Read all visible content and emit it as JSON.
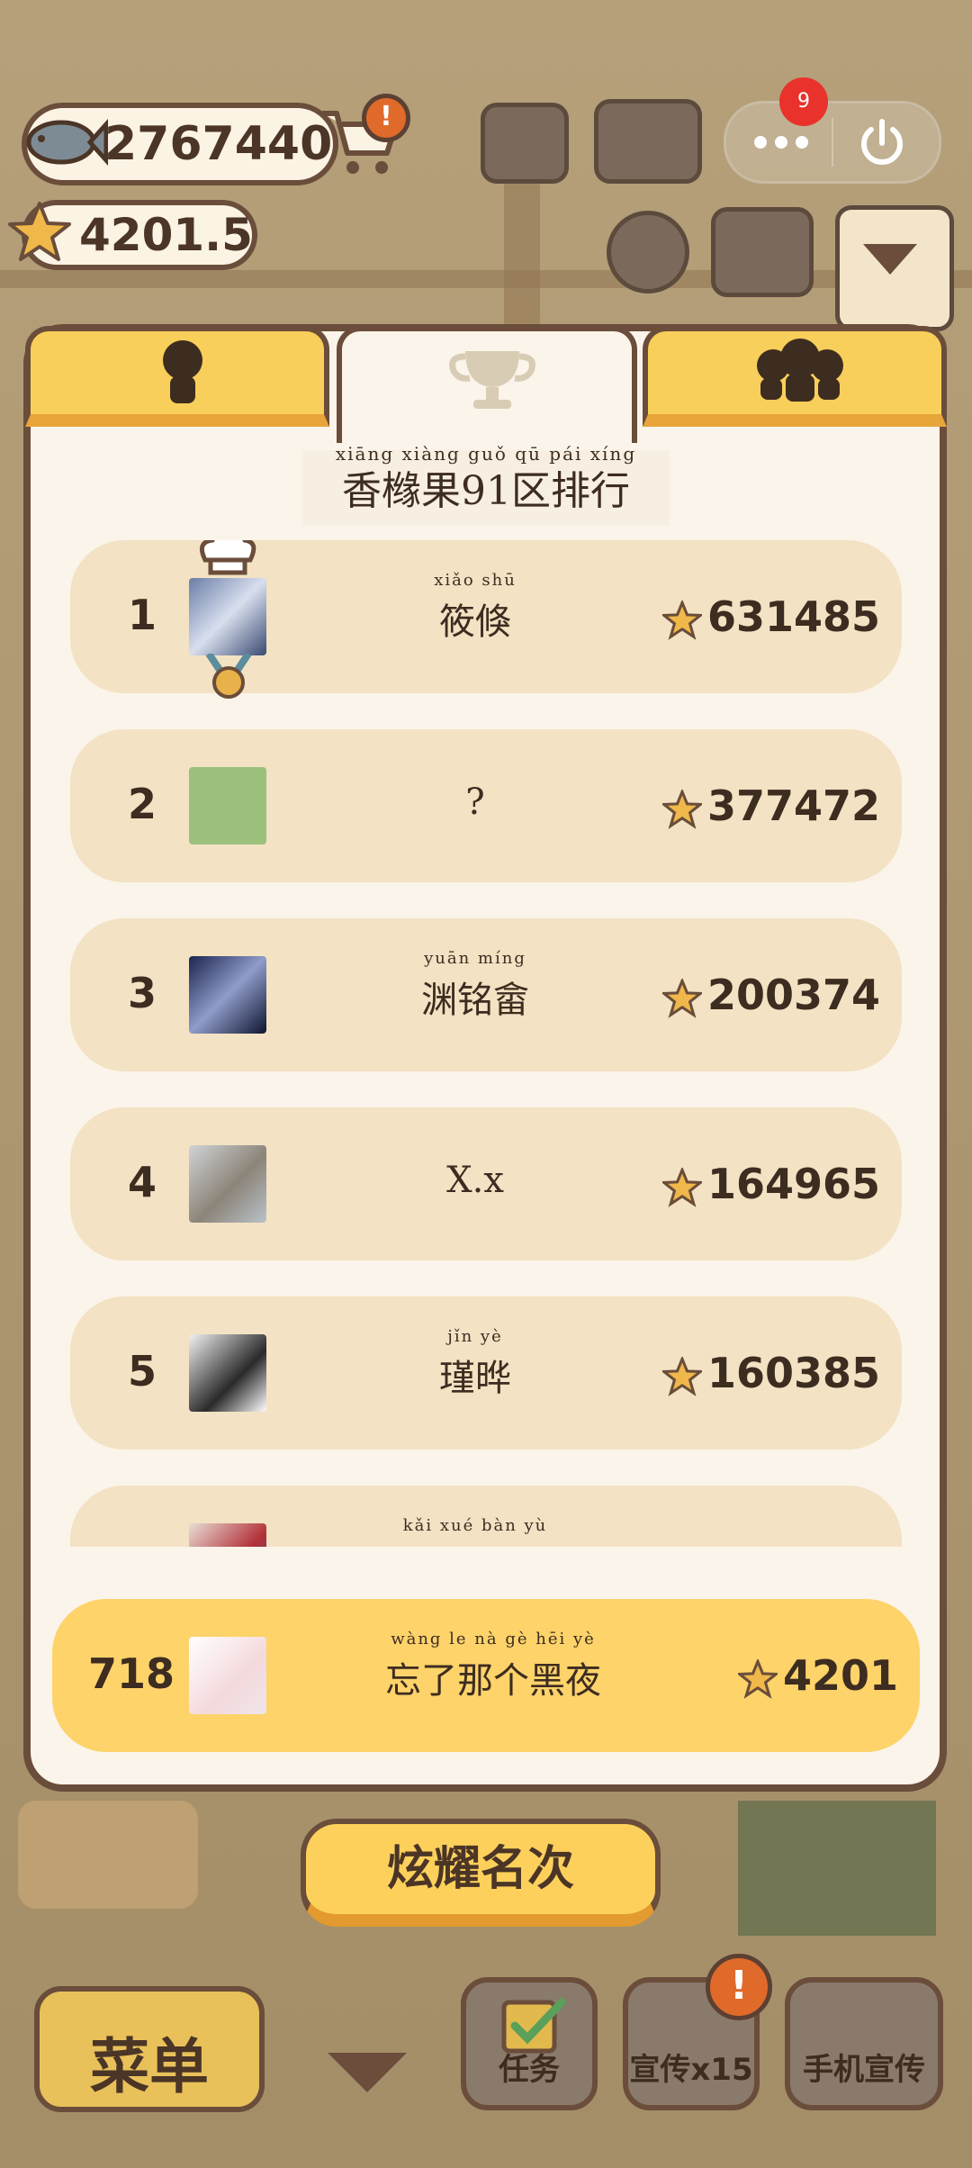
{
  "hud": {
    "fish_count": "2767440",
    "star_count": "4201.5",
    "notification_badge": "9"
  },
  "panel": {
    "title": "香橼果91区排行",
    "title_pinyin": "xiāng xiàng guǒ   qū  pái  xíng"
  },
  "ranking": [
    {
      "rank": "1",
      "name": "筱倏",
      "pinyin": "xiǎo shū",
      "score": "631485"
    },
    {
      "rank": "2",
      "name": "?",
      "pinyin": "",
      "score": "377472"
    },
    {
      "rank": "3",
      "name": "渊铭畲",
      "pinyin": "yuān míng",
      "score": "200374"
    },
    {
      "rank": "4",
      "name": "X.x",
      "pinyin": "",
      "score": "164965"
    },
    {
      "rank": "5",
      "name": "瑾晔",
      "pinyin": "jǐn yè",
      "score": "160385"
    }
  ],
  "partial_row": {
    "pinyin": "kǎi  xué  bàn  yù"
  },
  "my_entry": {
    "rank": "718",
    "name": "忘了那个黑夜",
    "pinyin": "wàng le  nà  gè  hēi  yè",
    "score": "4201"
  },
  "buttons": {
    "show_rank": "炫耀名次",
    "menu": "菜单",
    "tasks": "任务",
    "promote": "宣传x15",
    "phone_promote": "手机宣传"
  },
  "colors": {
    "accent_yellow": "#fdd36a",
    "row_bg": "#f3e2c3",
    "panel_bg": "#fbf4ea",
    "border_brown": "#6a4d3a",
    "alert_orange": "#e06a2a"
  }
}
